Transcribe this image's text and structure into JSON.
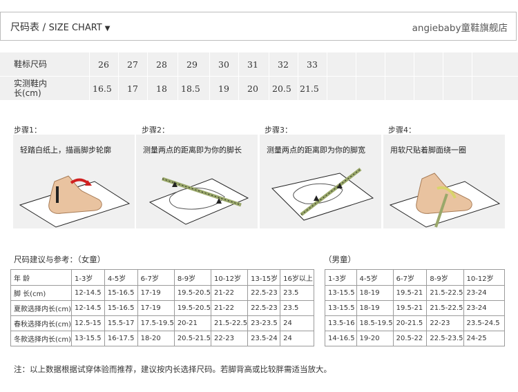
{
  "header": {
    "title_cn": "尺码表",
    "title_sep": " / ",
    "title_en": "SIZE CHART",
    "title_arrow": "▼",
    "brand": "angiebaby童鞋旗舰店"
  },
  "size_table": {
    "row1_label": "鞋标尺码",
    "row1_values": [
      "26",
      "27",
      "28",
      "29",
      "30",
      "31",
      "32",
      "33"
    ],
    "row2_label_line1": "实测鞋内",
    "row2_label_line2": "长(cm)",
    "row2_values": [
      "16.5",
      "17",
      "18",
      "18.5",
      "19",
      "20",
      "20.5",
      "21.5"
    ]
  },
  "steps": [
    {
      "label": "步骤1：",
      "caption": "轻踏白纸上，描画脚步轮廓",
      "icon": "foot-outline-icon"
    },
    {
      "label": "步骤2：",
      "caption": "测量两点的距离即为你的脚长",
      "icon": "ruler-length-icon"
    },
    {
      "label": "步骤3：",
      "caption": "测量两点的距离即为你的脚宽",
      "icon": "ruler-width-icon"
    },
    {
      "label": "步骤4：",
      "caption": "用软尺贴着脚面绕一圈",
      "icon": "tape-measure-icon"
    }
  ],
  "girls": {
    "title": "尺码建议与参考：（女童）",
    "rows": [
      [
        "年 龄",
        "1-3岁",
        "4-5岁",
        "6-7岁",
        "8-9岁",
        "10-12岁",
        "13-15岁",
        "16岁以上"
      ],
      [
        "脚 长(cm)",
        "12-14.5",
        "15-16.5",
        "17-19",
        "19.5-20.5",
        "21-22",
        "22.5-23",
        "23.5"
      ],
      [
        "夏款选择内长(cm)",
        "12-14.5",
        "15-16.5",
        "17-19",
        "19.5-20.5",
        "21-22",
        "22.5-23",
        "23.5"
      ],
      [
        "春秋选择内长(cm)",
        "12.5-15",
        "15.5-17",
        "17.5-19.5",
        "20-21",
        "21.5-22.5",
        "23-23.5",
        "24"
      ],
      [
        "冬款选择内长(cm)",
        "13-15.5",
        "16-17.5",
        "18-20",
        "20.5-21.5",
        "22-23",
        "23.5-24",
        "24"
      ]
    ]
  },
  "boys": {
    "title": "（男童）",
    "rows": [
      [
        "1-3岁",
        "4-5岁",
        "6-7岁",
        "8-9岁",
        "10-12岁"
      ],
      [
        "13-15.5",
        "18-19",
        "19.5-21",
        "21.5-22.5",
        "23-24"
      ],
      [
        "13-15.5",
        "18-19",
        "19.5-21",
        "21.5-22.5",
        "23-24"
      ],
      [
        "13.5-16",
        "18.5-19.5",
        "20-21.5",
        "22-23",
        "23.5-24.5"
      ],
      [
        "14-16.5",
        "19-20",
        "20.5-22",
        "22.5-23.5",
        "24-25"
      ]
    ]
  },
  "note": "注：以上数据根据试穿体验而推荐，建议按内长选择尺码。若脚背高或比较胖需适当放大。"
}
